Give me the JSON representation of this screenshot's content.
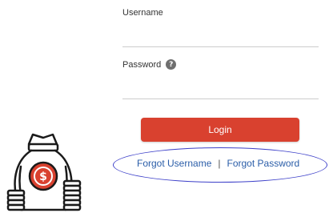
{
  "form": {
    "username_label": "Username",
    "username_value": "",
    "password_label": "Password",
    "password_value": "",
    "help_glyph": "?",
    "login_label": "Login"
  },
  "links": {
    "forgot_username": "Forgot Username",
    "separator": "|",
    "forgot_password": "Forgot Password"
  },
  "icons": {
    "help": "question-circle-icon",
    "illustration": "money-bag-icon"
  },
  "colors": {
    "login_button": "#d9412f",
    "link": "#2a5da8",
    "highlight": "#3d40c9",
    "coin": "#d9412f"
  }
}
